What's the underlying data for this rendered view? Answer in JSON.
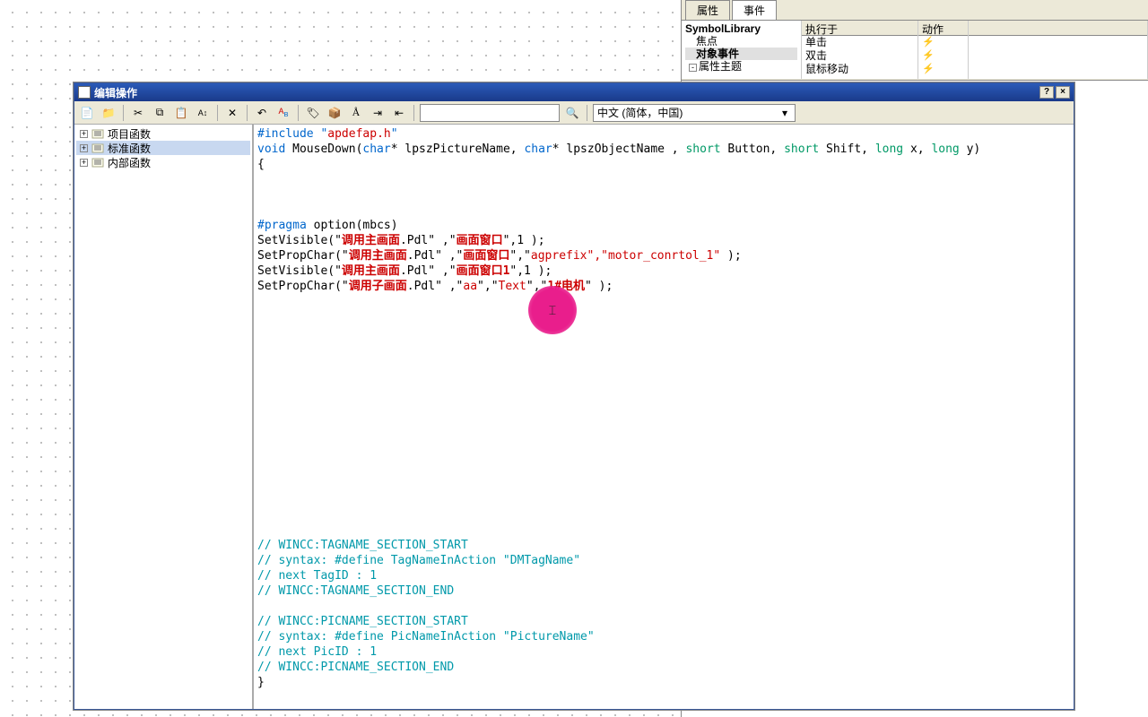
{
  "right_panel": {
    "tabs": {
      "t1": "属性",
      "t2": "事件"
    },
    "tree": {
      "root": "SymbolLibrary",
      "i1": "焦点",
      "i2": "对象事件",
      "i3": "属性主题"
    },
    "cols": {
      "c1": "执行于",
      "c2": "动作"
    },
    "events": {
      "e1": "单击",
      "e2": "双击",
      "e3": "鼠标移动"
    }
  },
  "dialog": {
    "title": "编辑操作",
    "help": "?",
    "close": "×",
    "toolbar": {
      "lang": "中文 (简体，中国)",
      "drop": "▾"
    }
  },
  "func_tree": {
    "f1": "项目函数",
    "f2": "标准函数",
    "f3": "内部函数"
  },
  "code": {
    "l1a": "#include \"",
    "l1b": "apdefap.h",
    "l1c": "\"",
    "l2a": "void",
    "l2b": " MouseDown(",
    "l2c": "char",
    "l2d": "* lpszPictureName, ",
    "l2e": "char",
    "l2f": "* lpszObjectName , ",
    "l2g": "short",
    "l2h": " Button, ",
    "l2i": "short",
    "l2j": " Shift, ",
    "l2k": "long",
    "l2l": " x, ",
    "l2m": "long",
    "l2n": " y)",
    "l3": "{",
    "l5a": "#pragma",
    "l5b": " option(mbcs)",
    "l6a": "SetVisible(\"",
    "l6b": "调用主画面",
    "l6c": ".Pdl\" ,\"",
    "l6d": "画面窗口",
    "l6e": "\",1 );",
    "l7a": "SetPropChar(\"",
    "l7b": "调用主画面",
    "l7c": ".Pdl\" ,\"",
    "l7d": "画面窗口",
    "l7e": "\",\"",
    "l7f": "agprefix\",\"motor_conrtol_1\"",
    "l7g": " );",
    "l8a": "SetVisible(\"",
    "l8b": "调用主画面",
    "l8c": ".Pdl\" ,\"",
    "l8d": "画面窗口1",
    "l8e": "\",1 );",
    "l9a": "SetPropChar(\"",
    "l9b": "调用子画面",
    "l9c": ".Pdl\" ,\"",
    "l9d": "aa",
    "l9e": "\",\"",
    "l9f": "Text",
    "l9g": "\",\"",
    "l9h": "1#电机",
    "l9i": "\" );",
    "c1": "// WINCC:TAGNAME_SECTION_START",
    "c2": "// syntax: #define TagNameInAction \"DMTagName\"",
    "c3": "// next TagID : 1",
    "c4": "// WINCC:TAGNAME_SECTION_END",
    "c5": "// WINCC:PICNAME_SECTION_START",
    "c6": "// syntax: #define PicNameInAction \"PictureName\"",
    "c7": "// next PicID : 1",
    "c8": "// WINCC:PICNAME_SECTION_END",
    "c9": "}"
  }
}
